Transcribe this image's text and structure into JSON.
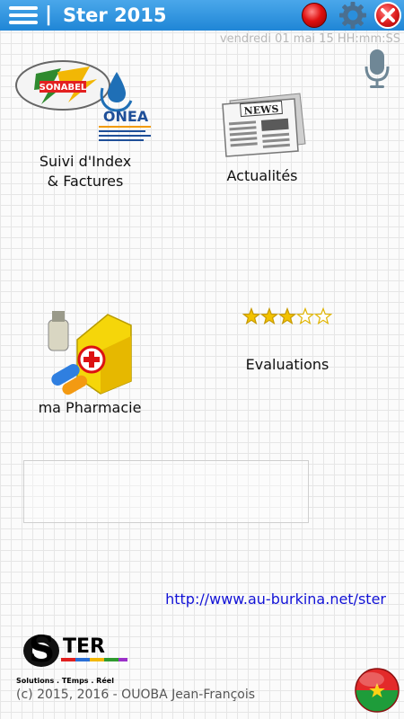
{
  "app": {
    "title": "Ster 2015",
    "separator": "|"
  },
  "header": {
    "datetime": "vendredi 01 mai 15 HH:mm:SS"
  },
  "tiles": {
    "index": {
      "label_line1": "Suivi d'Index",
      "label_line2": "& Factures",
      "logo_text_1": "SONABEL",
      "logo_text_2": "ONEA"
    },
    "news": {
      "label": "Actualités",
      "image_text": "NEWS"
    },
    "pharmacy": {
      "label": "ma Pharmacie"
    },
    "ratings": {
      "label": "Evaluations",
      "rating": 3,
      "max": 5
    }
  },
  "footer": {
    "url": "http://www.au-burkina.net/ster",
    "brand": "STER",
    "tagline": "Solutions . TEmps . Réel",
    "copyright": "(c) 2015, 2016  - OUOBA Jean-François"
  },
  "icons": {
    "menu": "hamburger-icon",
    "record": "record-icon",
    "settings": "gear-icon",
    "close": "close-icon",
    "mic": "microphone-icon",
    "flag": "burkina-flag-icon"
  },
  "colors": {
    "topbar": "#2a8fdc",
    "link": "#1212d6"
  }
}
